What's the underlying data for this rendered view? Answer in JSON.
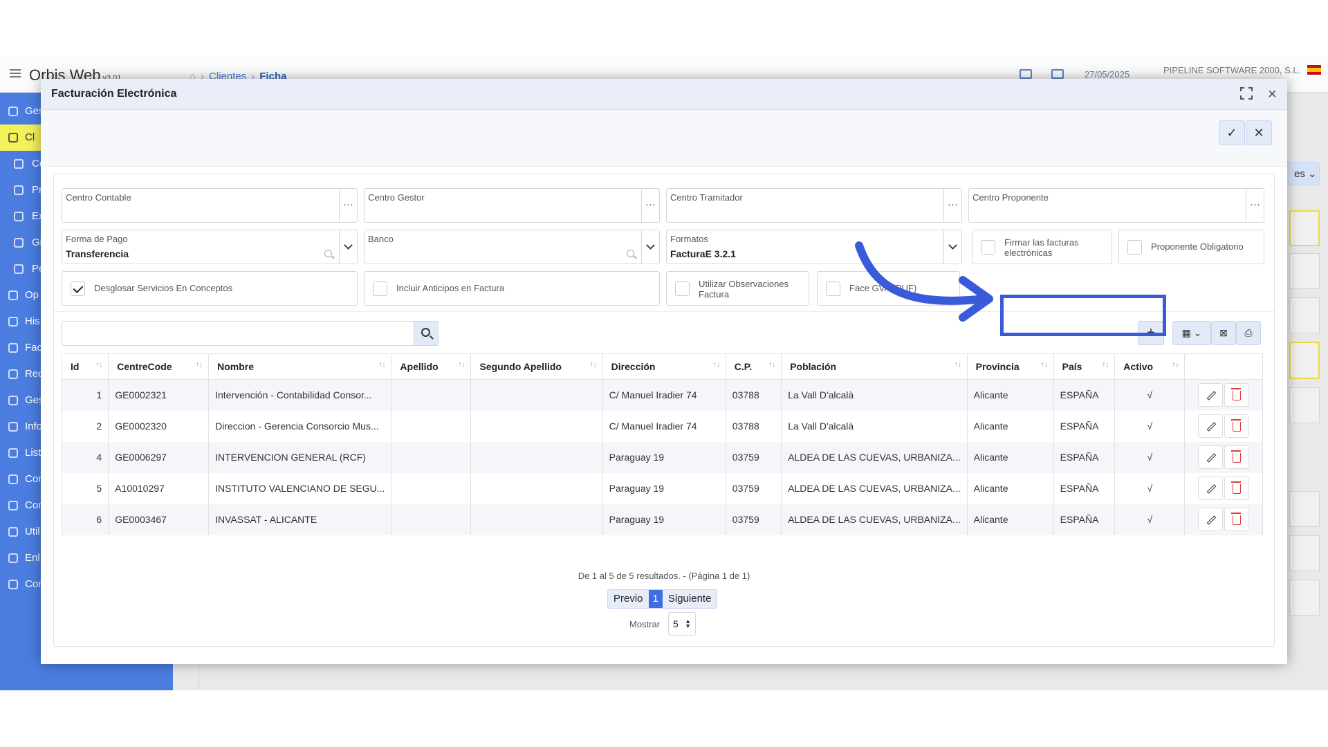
{
  "app": {
    "brand": "Orbis Web",
    "version": "v3.01",
    "breadcrumb": [
      "Clientes",
      "Ficha"
    ],
    "date": "27/05/2025",
    "company": "PIPELINE SOFTWARE 2000, S.L."
  },
  "sidebar": {
    "items": [
      {
        "label": "Ges"
      },
      {
        "label": "Cl"
      },
      {
        "label": "Co"
      },
      {
        "label": "Pr"
      },
      {
        "label": "Ex"
      },
      {
        "label": "Gi"
      },
      {
        "label": "Pe"
      },
      {
        "label": "Op"
      },
      {
        "label": "His"
      },
      {
        "label": "Fac"
      },
      {
        "label": "Rec"
      },
      {
        "label": "Ges"
      },
      {
        "label": "Info"
      },
      {
        "label": "List"
      },
      {
        "label": "Con"
      },
      {
        "label": "Con"
      },
      {
        "label": "Util"
      },
      {
        "label": "Enl"
      },
      {
        "label": "Con"
      }
    ]
  },
  "background": {
    "button_label": "es"
  },
  "modal": {
    "title": "Facturación Electrónica",
    "fields": {
      "centro_contable": {
        "label": "Centro Contable",
        "value": ""
      },
      "centro_gestor": {
        "label": "Centro Gestor",
        "value": ""
      },
      "centro_tramitador": {
        "label": "Centro Tramitador",
        "value": ""
      },
      "centro_proponente": {
        "label": "Centro Proponente",
        "value": ""
      },
      "forma_pago": {
        "label": "Forma de Pago",
        "value": "Transferencia"
      },
      "banco": {
        "label": "Banco",
        "value": ""
      },
      "formatos": {
        "label": "Formatos",
        "value": "FacturaE 3.2.1"
      }
    },
    "checkboxes": {
      "firmar": {
        "label": "Firmar las facturas electrónicas",
        "checked": false
      },
      "proponente_obligatorio": {
        "label": "Proponente Obligatorio",
        "checked": false
      },
      "desglosar": {
        "label": "Desglosar Servicios En Conceptos",
        "checked": true
      },
      "anticipos": {
        "label": "Incluir Anticipos en Factura",
        "checked": false
      },
      "observaciones": {
        "label": "Utilizar Observaciones Factura",
        "checked": false
      },
      "face_gva": {
        "label": "Face GVA (RUF)",
        "checked": false
      }
    },
    "search": {
      "placeholder": ""
    },
    "table": {
      "columns": [
        "Id",
        "CentreCode",
        "Nombre",
        "Apellido",
        "Segundo Apellido",
        "Dirección",
        "C.P.",
        "Población",
        "Provincia",
        "País",
        "Activo"
      ],
      "rows": [
        {
          "id": "1",
          "code": "GE0002321",
          "nombre": "Intervención - Contabilidad Consor...",
          "apellido": "",
          "segundo": "",
          "direccion": "C/ Manuel Iradier 74",
          "cp": "03788",
          "poblacion": "La Vall D'alcalà",
          "provincia": "Alicante",
          "pais": "ESPAÑA",
          "activo": "√"
        },
        {
          "id": "2",
          "code": "GE0002320",
          "nombre": "Direccion - Gerencia Consorcio Mus...",
          "apellido": "",
          "segundo": "",
          "direccion": "C/ Manuel Iradier 74",
          "cp": "03788",
          "poblacion": "La Vall D'alcalà",
          "provincia": "Alicante",
          "pais": "ESPAÑA",
          "activo": "√"
        },
        {
          "id": "4",
          "code": "GE0006297",
          "nombre": "INTERVENCION GENERAL (RCF)",
          "apellido": "",
          "segundo": "",
          "direccion": "Paraguay 19",
          "cp": "03759",
          "poblacion": "ALDEA DE LAS CUEVAS, URBANIZA...",
          "provincia": "Alicante",
          "pais": "ESPAÑA",
          "activo": "√"
        },
        {
          "id": "5",
          "code": "A10010297",
          "nombre": "INSTITUTO VALENCIANO DE SEGU...",
          "apellido": "",
          "segundo": "",
          "direccion": "Paraguay 19",
          "cp": "03759",
          "poblacion": "ALDEA DE LAS CUEVAS, URBANIZA...",
          "provincia": "Alicante",
          "pais": "ESPAÑA",
          "activo": "√"
        },
        {
          "id": "6",
          "code": "GE0003467",
          "nombre": "INVASSAT - ALICANTE",
          "apellido": "",
          "segundo": "",
          "direccion": "Paraguay 19",
          "cp": "03759",
          "poblacion": "ALDEA DE LAS CUEVAS, URBANIZA...",
          "provincia": "Alicante",
          "pais": "ESPAÑA",
          "activo": "√"
        }
      ]
    },
    "pagination": {
      "summary": "De 1 al 5 de 5 resultados. - (Página 1 de 1)",
      "prev": "Previo",
      "current": "1",
      "next": "Siguiente",
      "show_label": "Mostrar",
      "page_size": "5"
    }
  },
  "colors": {
    "sidebar": "#4b7de0",
    "active_nav": "#f4f05a",
    "annotation": "#3a5bd9",
    "pager_active": "#3d6fe0"
  }
}
